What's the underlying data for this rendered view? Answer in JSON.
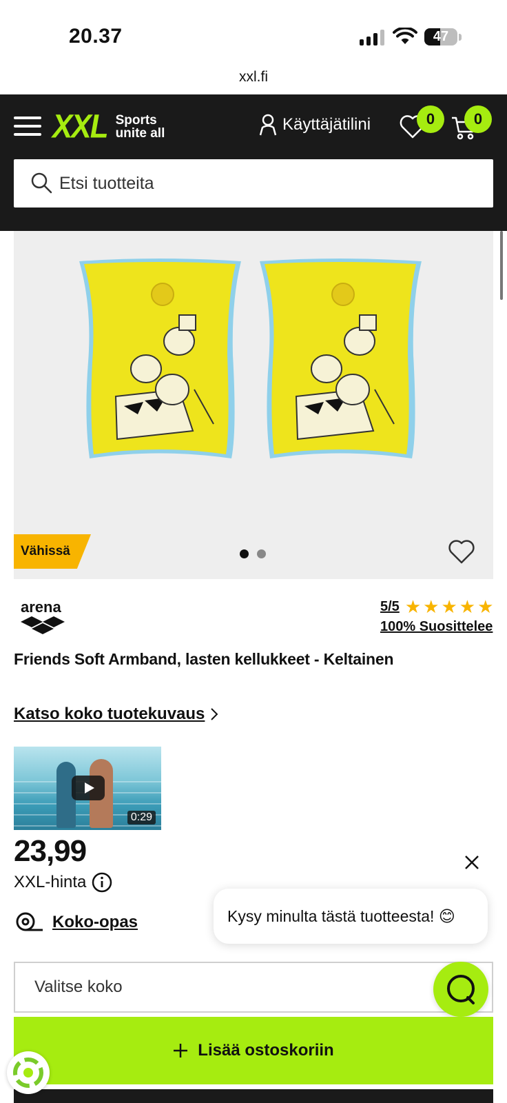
{
  "status_bar": {
    "time": "20.37",
    "battery": "47",
    "battery_level": 0.47
  },
  "browser": {
    "url": "xxl.fi"
  },
  "header": {
    "logo_mark": "XXL",
    "logo_tagline_1": "Sports",
    "logo_tagline_2": "unite all",
    "account_label": "Käyttäjätilini",
    "wishlist_count": "0",
    "cart_count": "0",
    "search_placeholder": "Etsi tuotteita"
  },
  "gallery": {
    "promo_badge": "Vähissä",
    "image_count": 2,
    "active_index": 0
  },
  "product": {
    "brand": "arena",
    "rating": "5/5",
    "stars": 5,
    "recommend": "100% Suosittelee",
    "title": "Friends Soft Armband, lasten kellukkeet - Keltainen",
    "description_link": "Katso koko tuotekuvaus",
    "video_duration": "0:29",
    "price": "23,99",
    "price_label": "XXL-hinta",
    "size_guide": "Koko-opas",
    "size_placeholder": "Valitse koko",
    "add_to_cart": "Lisää ostoskoriin"
  },
  "chat": {
    "bubble_text": "Kysy minulta tästä tuotteesta! 😊"
  },
  "colors": {
    "accent": "#a6ec10",
    "header_bg": "#1a1a1a",
    "promo": "#f8b400",
    "star": "#f8b400"
  }
}
